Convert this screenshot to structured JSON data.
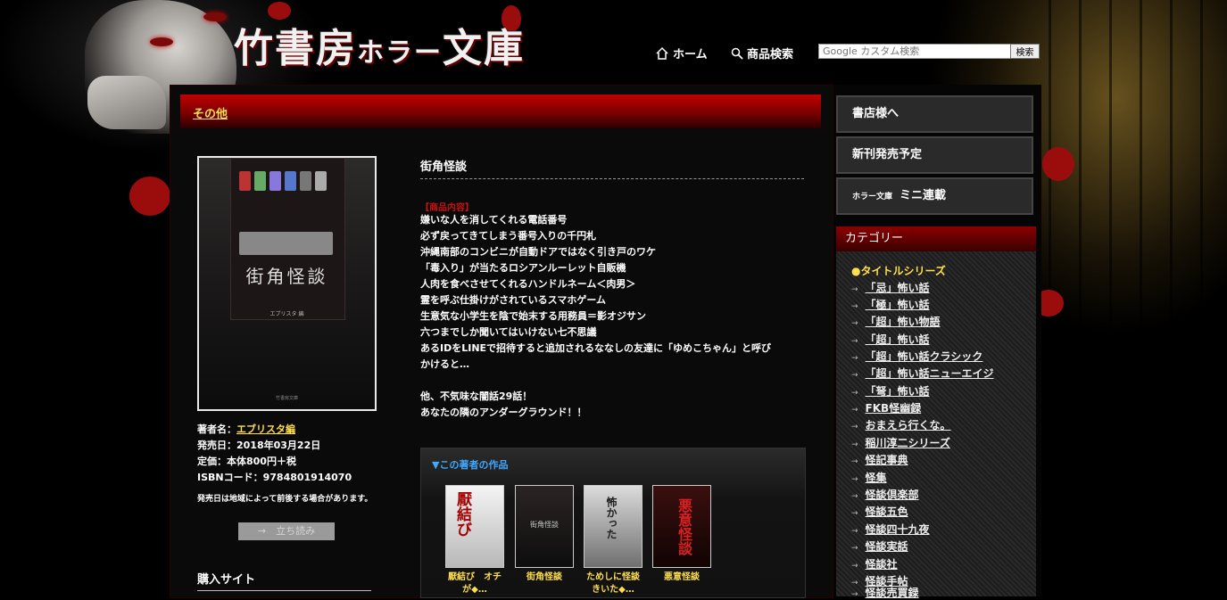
{
  "header": {
    "logo_main": "竹書房",
    "logo_horror": "ホラー",
    "logo_bunko": "文庫",
    "nav": {
      "home": "ホーム",
      "product_search": "商品検索"
    },
    "search": {
      "placeholder": "Google カスタム検索",
      "button": "検索"
    }
  },
  "section": {
    "title": "その他"
  },
  "book": {
    "title": "街角怪談",
    "cover": {
      "title": "街角怪談",
      "author": "エブリスタ 編",
      "publisher": "竹書房文庫"
    },
    "author_label": "著者名：",
    "author": "エブリスタ編",
    "release": "発売日：2018年03月22日",
    "price": "定価：本体800円＋税",
    "isbn": "ISBNコード：9784801914070",
    "release_note": "発売日は地域によって前後する場合があります。",
    "read_button": "→　立ち読み",
    "buy_heading": "購入サイト",
    "description_label": "【商品内容】",
    "description": [
      "嫌いな人を消してくれる電話番号",
      "必ず戻ってきてしまう番号入りの千円札",
      "沖縄南部のコンビニが自動ドアではなく引き戸のワケ",
      "「毒入り」が当たるロシアンルーレット自販機",
      "人肉を食べさせてくれるハンドルネーム＜肉男＞",
      "霊を呼ぶ仕掛けがされているスマホゲーム",
      "生意気な小学生を陰で始末する用務員＝影オジサン",
      "六つまでしか聞いてはいけない七不思議",
      "あるIDをLINEで招待すると追加されるななしの友達に「ゆめこちゃん」と呼び",
      "かけると…",
      "",
      "他、不気味な闇話29話！",
      "あなたの隣のアンダーグラウンド！！"
    ]
  },
  "author_works": {
    "heading": "▼この著者の作品",
    "items": [
      {
        "label": "厭結び　オチ\nが◆…",
        "cover_text": "厭結び"
      },
      {
        "label": "街角怪談",
        "cover_text": "街角怪談"
      },
      {
        "label": "ためしに怪談\nきいた◆…",
        "cover_text": "怖かった"
      },
      {
        "label": "悪意怪談",
        "cover_text": "悪意怪談"
      }
    ]
  },
  "sidebar": {
    "for_stores": "書店様へ",
    "new_releases": "新刊発売予定",
    "mini_serial_prefix": "ホラー文庫",
    "mini_serial": "ミニ連載",
    "category_header": "カテゴリー",
    "series_title": "●タイトルシリーズ",
    "categories": [
      "「忌」怖い話",
      "「極」怖い話",
      "「超」怖い物語",
      "「超」怖い話",
      "「超」怖い話クラシック",
      "「超」怖い話ニューエイジ",
      "「弩」怖い話",
      "FKB怪幽録",
      "おまえら行くな。",
      "稲川淳二シリーズ",
      "怪記事典",
      "怪集",
      "怪談倶楽部",
      "怪談五色",
      "怪談四十九夜",
      "怪談実話",
      "怪談社",
      "怪談手帖",
      "怪談売買録"
    ]
  }
}
